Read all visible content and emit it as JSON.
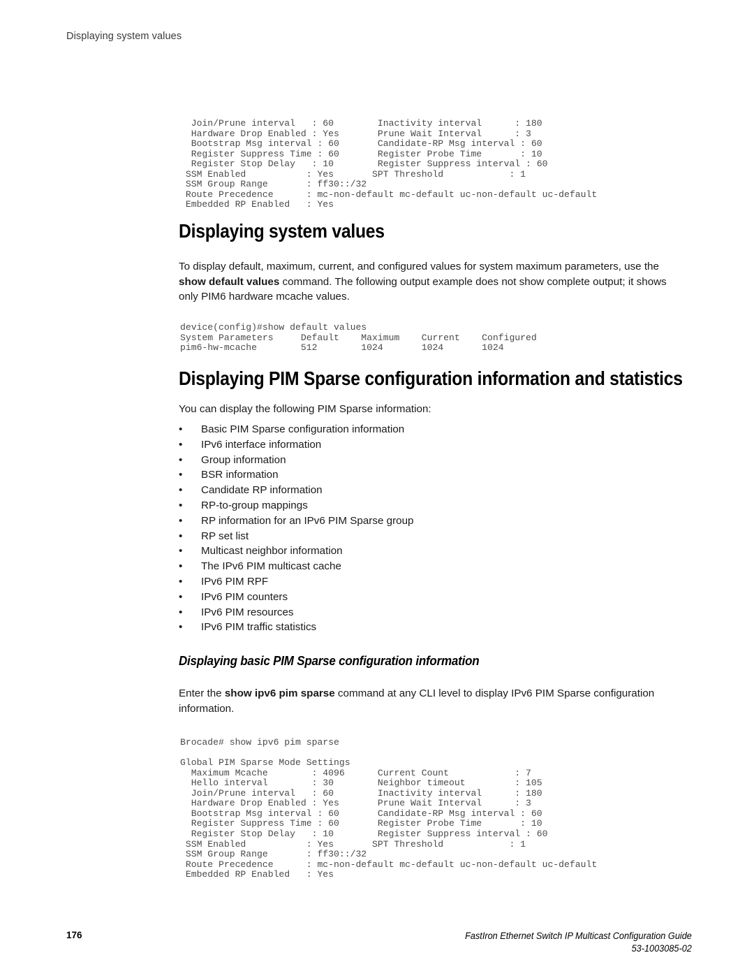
{
  "running_header": "Displaying system values",
  "code_top": [
    "  Join/Prune interval   : 60        Inactivity interval      : 180",
    "  Hardware Drop Enabled : Yes       Prune Wait Interval      : 3",
    "  Bootstrap Msg interval : 60       Candidate-RP Msg interval : 60",
    "  Register Suppress Time : 60       Register Probe Time       : 10",
    "  Register Stop Delay   : 10        Register Suppress interval : 60",
    " SSM Enabled           : Yes       SPT Threshold            : 1",
    " SSM Group Range       : ff30::/32",
    " Route Precedence      : mc-non-default mc-default uc-non-default uc-default",
    " Embedded RP Enabled   : Yes"
  ],
  "heading_system_values": "Displaying system values",
  "paragraph_intro": {
    "part1": "To display default, maximum, current, and configured values for system maximum parameters, use the ",
    "bold1": "show default values",
    "part2": " command. The following output example does not show complete output; it shows only PIM6 hardware mcache values."
  },
  "code_mid": [
    "device(config)#show default values",
    "System Parameters     Default    Maximum    Current    Configured",
    "pim6-hw-mcache        512        1024       1024       1024"
  ],
  "heading_pim_sparse": "Displaying PIM Sparse configuration information and statistics",
  "paragraph_youcan": "You can display the following PIM Sparse information:",
  "bullets": [
    "Basic PIM Sparse configuration information",
    "IPv6 interface information",
    "Group information",
    "BSR information",
    "Candidate RP information",
    "RP-to-group mappings",
    "RP information for an IPv6 PIM Sparse group",
    "RP set list",
    "Multicast neighbor information",
    "The IPv6 PIM multicast cache",
    "IPv6 PIM RPF",
    "IPv6 PIM counters",
    "IPv6 PIM resources",
    "IPv6 PIM traffic statistics"
  ],
  "bullet_marker": "•",
  "heading_basic_pim": "Displaying basic PIM Sparse configuration information",
  "paragraph_enter": {
    "part1": "Enter the ",
    "bold1": "show ipv6 pim sparse",
    "part2": " command at any CLI level to display IPv6 PIM Sparse configuration information."
  },
  "code_bottom": [
    "Brocade# show ipv6 pim sparse",
    "",
    "Global PIM Sparse Mode Settings",
    "  Maximum Mcache        : 4096      Current Count            : 7",
    "  Hello interval        : 30        Neighbor timeout         : 105",
    "  Join/Prune interval   : 60        Inactivity interval      : 180",
    "  Hardware Drop Enabled : Yes       Prune Wait Interval      : 3",
    "  Bootstrap Msg interval : 60       Candidate-RP Msg interval : 60",
    "  Register Suppress Time : 60       Register Probe Time       : 10",
    "  Register Stop Delay   : 10        Register Suppress interval : 60",
    " SSM Enabled           : Yes       SPT Threshold            : 1",
    " SSM Group Range       : ff30::/32",
    " Route Precedence      : mc-non-default mc-default uc-non-default uc-default",
    " Embedded RP Enabled   : Yes"
  ],
  "footer": {
    "page_number": "176",
    "guide_title": "FastIron Ethernet Switch IP Multicast Configuration Guide",
    "doc_number": "53-1003085-02"
  }
}
